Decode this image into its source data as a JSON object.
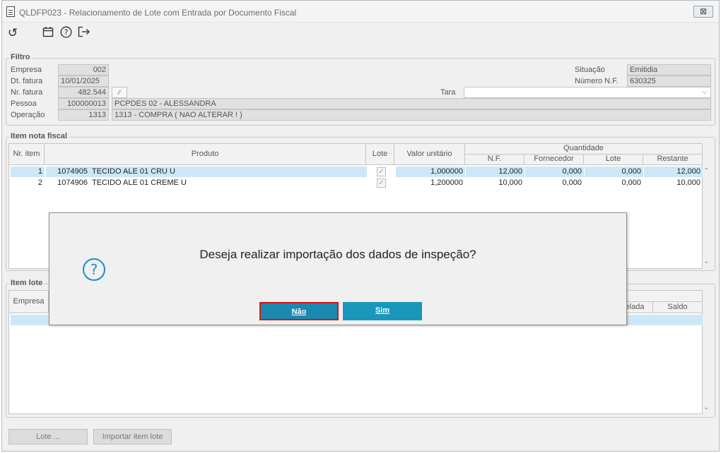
{
  "window": {
    "title": "QLDFP023 - Relacionamento de Lote com Entrada por Documento Fiscal",
    "close_label": "⊠"
  },
  "toolbar": {
    "icons": [
      "refresh-icon",
      "calendar-icon",
      "help-icon",
      "exit-icon"
    ]
  },
  "filter": {
    "group_label": "Filtro",
    "empresa_label": "Empresa",
    "empresa": "002",
    "dt_fatura_label": "Dt. fatura",
    "dt_fatura": "10/01/2025",
    "nr_fatura_label": "Nr. fatura",
    "nr_fatura": "482.544",
    "pessoa_label": "Pessoa",
    "pessoa_code": "100000013",
    "pessoa_name": "PCPDES 02 - ALESSANDRA",
    "operacao_label": "Operação",
    "operacao_code": "1313",
    "operacao_name": "1313 - COMPRA ( NAO ALTERAR ! )",
    "tara_label": "Tara",
    "tara": "",
    "situacao_label": "Situação",
    "situacao": "Emitidia",
    "numero_nf_label": "Número N.F.",
    "numero_nf": "630325"
  },
  "item_nf": {
    "group_label": "Item nota fiscal",
    "headers": {
      "nr_item": "Nr. item",
      "produto": "Produto",
      "lote": "Lote",
      "valor_unitario": "Valor unitário",
      "quantidade": "Quantidade",
      "nf": "N.F.",
      "fornecedor": "Fornecedor",
      "lote_q": "Lote",
      "restante": "Restante"
    },
    "rows": [
      {
        "nr": "1",
        "code": "1074905",
        "desc": "TECIDO ALE 01 CRU U",
        "lote": true,
        "valor": "1,000000",
        "nf": "12,000",
        "fornecedor": "0,000",
        "lote_q": "0,000",
        "restante": "12,000"
      },
      {
        "nr": "2",
        "code": "1074906",
        "desc": "TECIDO ALE 01 CREME U",
        "lote": true,
        "valor": "1,200000",
        "nf": "10,000",
        "fornecedor": "0,000",
        "lote_q": "0,000",
        "restante": "10,000"
      }
    ]
  },
  "item_lote": {
    "group_label": "Item lote",
    "headers": {
      "empresa": "Empresa",
      "cancelada": "elada",
      "saldo": "Saldo"
    }
  },
  "buttons": {
    "lote": "Lote ...",
    "importar": "Importar item lote"
  },
  "dialog": {
    "message": "Deseja realizar importação dos dados de inspeção?",
    "no": "Não",
    "yes": "Sim",
    "icon": "question-icon"
  }
}
